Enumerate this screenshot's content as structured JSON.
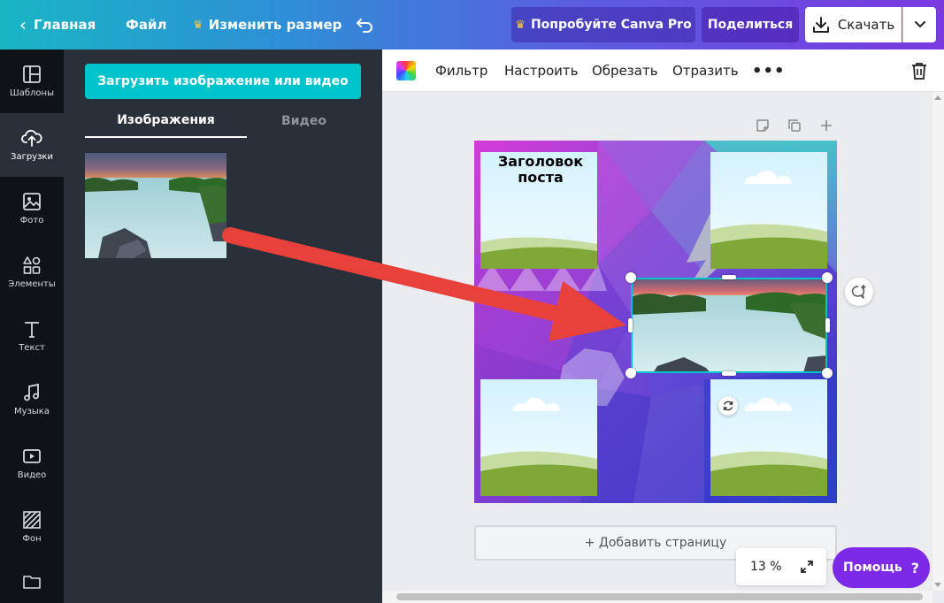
{
  "topbar": {
    "home": "Главная",
    "file": "Файл",
    "resize": "Изменить размер",
    "try_pro": "Попробуйте Canva Pro",
    "share": "Поделиться",
    "download": "Скачать"
  },
  "rail": {
    "items": [
      {
        "label": "Шаблоны",
        "icon": "templates-icon"
      },
      {
        "label": "Загрузки",
        "icon": "upload-icon"
      },
      {
        "label": "Фото",
        "icon": "photo-icon"
      },
      {
        "label": "Элементы",
        "icon": "elements-icon"
      },
      {
        "label": "Текст",
        "icon": "text-icon"
      },
      {
        "label": "Музыка",
        "icon": "music-icon"
      },
      {
        "label": "Видео",
        "icon": "video-icon"
      },
      {
        "label": "Фон",
        "icon": "background-icon"
      },
      {
        "label": "",
        "icon": "folder-icon"
      }
    ],
    "active": "Загрузки"
  },
  "panel": {
    "upload_button": "Загрузить изображение или видео",
    "tabs": [
      "Изображения",
      "Видео"
    ],
    "active_tab": "Изображения"
  },
  "toolbar": {
    "filter": "Фильтр",
    "adjust": "Настроить",
    "crop": "Обрезать",
    "flip": "Отразить",
    "more": "•••"
  },
  "canvas": {
    "title_text": "Заголовок поста",
    "add_page": "+ Добавить страницу",
    "zoom": "13 %",
    "help": "Помощь",
    "help_symbol": "?"
  },
  "colors": {
    "accent": "#00c4cc",
    "arrow": "#e8413b",
    "help": "#7d2ae8"
  }
}
